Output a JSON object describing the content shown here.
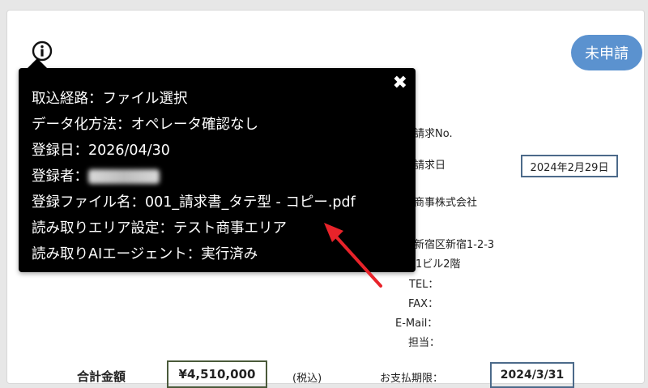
{
  "status_badge": "未申請",
  "tooltip": {
    "close_label": "✖",
    "lines": [
      "取込経路：ファイル選択",
      "データ化方法：オペレータ確認なし",
      "登録日：2026/04/30",
      "登録者：",
      "登録ファイル名：001_請求書_タテ型 - コピー.pdf",
      "読み取りエリア設定：テスト商事エリア",
      "読み取りAIエージェント：実行済み"
    ]
  },
  "invoice": {
    "invoice_no_label": "請求No.",
    "invoice_date_label": "請求日",
    "invoice_date": "2024年2月29日",
    "company_name": "商事株式会社",
    "address_line1": "新宿区新宿1-2-3",
    "address_line2": "1ビル2階",
    "tel_label": "TEL：",
    "fax_label": "FAX：",
    "email_label": "E-Mail：",
    "contact_label": "担当：",
    "total_label": "合計金額",
    "total_value": "¥4,510,000",
    "tax_note": "(税込)",
    "due_label": "お支払期限：",
    "due_value": "2024/3/31"
  },
  "icons": {
    "info": "info-circle-icon",
    "close": "close-icon",
    "annotation": "red-arrow-annotation"
  },
  "colors": {
    "badge": "#5b92cf",
    "tooltip_bg": "#000000",
    "arrow": "#e8232a"
  }
}
